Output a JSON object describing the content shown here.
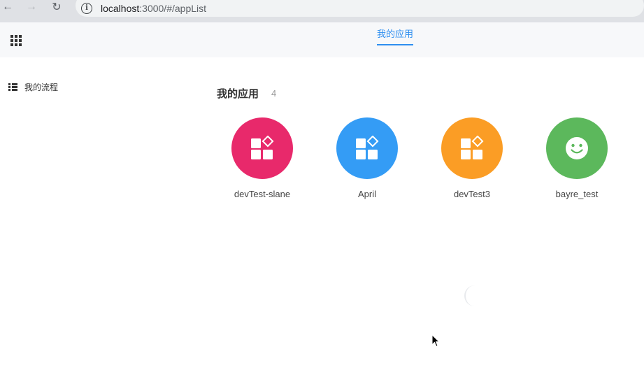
{
  "browser": {
    "url_host": "localhost",
    "url_path": ":3000/#/appList",
    "back_icon": "←",
    "forward_icon": "→",
    "reload_icon": "↻",
    "info_icon": "i"
  },
  "header": {
    "tab_label": "我的应用"
  },
  "sidebar": {
    "items": [
      {
        "label": "我的流程"
      }
    ]
  },
  "main": {
    "title": "我的应用",
    "count": "4",
    "apps": [
      {
        "name": "devTest-slane",
        "color": "#e8296b",
        "icon": "widgets-icon"
      },
      {
        "name": "April",
        "color": "#349cf5",
        "icon": "widgets-icon"
      },
      {
        "name": "devTest3",
        "color": "#fb9d25",
        "icon": "widgets-icon"
      },
      {
        "name": "bayre_test",
        "color": "#5cb85c",
        "icon": "smiley-icon"
      }
    ]
  }
}
